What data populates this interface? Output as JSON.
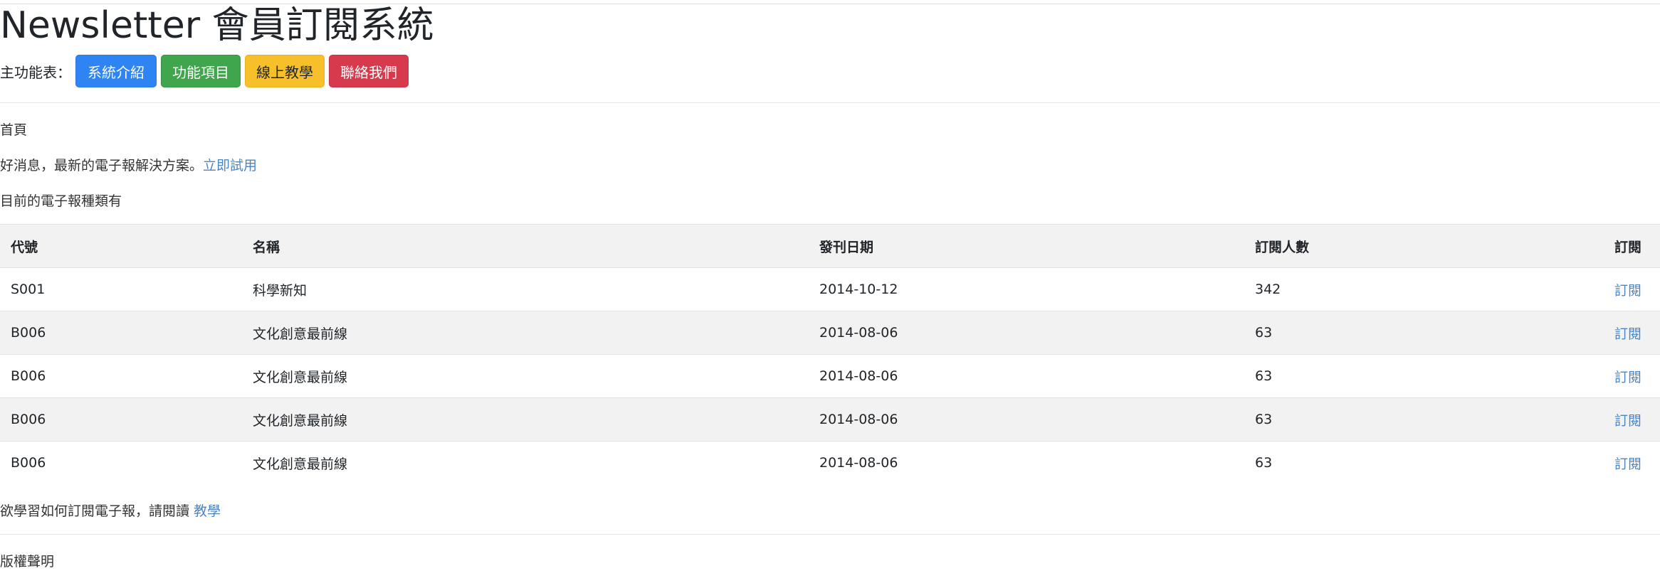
{
  "header": {
    "title": "Newsletter 會員訂閱系統",
    "menu_label": "主功能表：",
    "buttons": {
      "intro": "系統介紹",
      "features": "功能項目",
      "tutorial": "線上教學",
      "contact": "聯絡我們"
    }
  },
  "main": {
    "breadcrumb": "首頁",
    "promo_text": "好消息，最新的電子報解決方案。",
    "promo_link": "立即試用",
    "list_caption": "目前的電子報種類有",
    "table": {
      "headers": [
        "代號",
        "名稱",
        "發刊日期",
        "訂閱人數",
        "訂閱"
      ],
      "rows": [
        {
          "code": "S001",
          "name": "科學新知",
          "date": "2014-10-12",
          "subscribers": "342",
          "action": "訂閱"
        },
        {
          "code": "B006",
          "name": "文化創意最前線",
          "date": "2014-08-06",
          "subscribers": "63",
          "action": "訂閱"
        },
        {
          "code": "B006",
          "name": "文化創意最前線",
          "date": "2014-08-06",
          "subscribers": "63",
          "action": "訂閱"
        },
        {
          "code": "B006",
          "name": "文化創意最前線",
          "date": "2014-08-06",
          "subscribers": "63",
          "action": "訂閱"
        },
        {
          "code": "B006",
          "name": "文化創意最前線",
          "date": "2014-08-06",
          "subscribers": "63",
          "action": "訂閱"
        }
      ]
    },
    "help_text": "欲學習如何訂閱電子報，請閱讀 ",
    "help_link": "教學"
  },
  "footer": {
    "copyright": "版權聲明"
  },
  "colors": {
    "primary": "#2f84f3",
    "success": "#40a64e",
    "warning": "#f7c02b",
    "danger": "#d73a4c",
    "link": "#4a86c5",
    "stripe": "#f2f2f2"
  }
}
